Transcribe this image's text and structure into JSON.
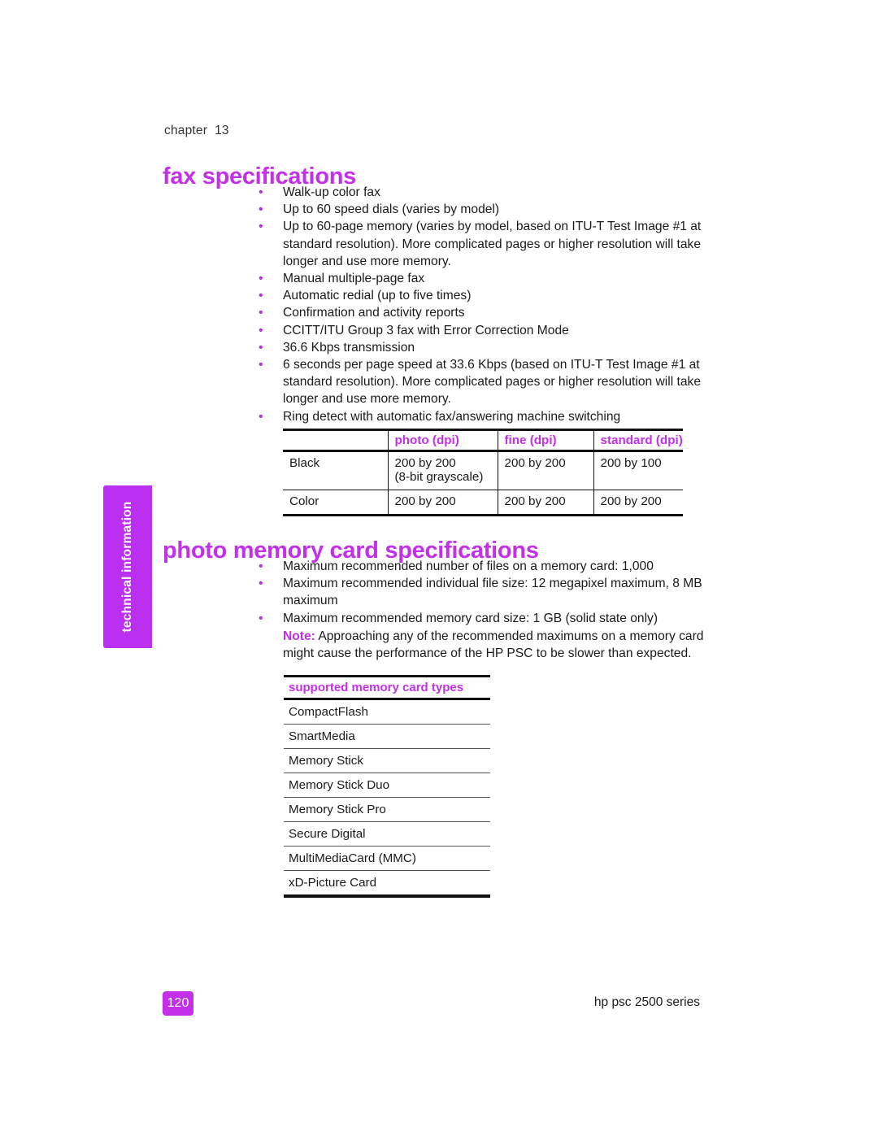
{
  "document": {
    "chapter_eyebrow": "chapter  13",
    "side_tab_label": "technical information",
    "page_number": "120",
    "footer_right": "hp psc 2500 series",
    "accent_color": "#c42fe9",
    "tab_color": "#bb2ff0"
  },
  "sections": [
    {
      "heading": "fax specifications",
      "bullets": [
        "Walk-up color fax",
        "Up to 60 speed dials (varies by model)",
        "Up to 60-page memory (varies by model, based on ITU-T Test Image #1 at standard resolution). More complicated pages or higher resolution will take longer and use more memory.",
        "Manual multiple-page fax",
        "Automatic redial (up to five times)",
        "Confirmation and activity reports",
        "CCITT/ITU Group 3 fax with Error Correction Mode",
        "36.6 Kbps transmission",
        "6 seconds per page speed at 33.6 Kbps (based on ITU-T Test Image #1 at standard resolution). More complicated pages or higher resolution will take longer and use more memory.",
        "Ring detect with automatic fax/answering machine switching"
      ]
    },
    {
      "heading": "photo memory card specifications",
      "bullets": [
        "Maximum recommended number of files on a memory card: 1,000",
        "Maximum recommended individual file size: 12 megapixel maximum, 8 MB maximum",
        "Maximum recommended memory card size: 1 GB (solid state only)"
      ],
      "note": {
        "label": "Note:",
        "text": "Approaching any of the recommended maximums on a memory card might cause the performance of the HP PSC to be slower than expected."
      }
    }
  ],
  "resolution_table": {
    "headers": [
      "",
      "photo (dpi)",
      "fine (dpi)",
      "standard (dpi)"
    ],
    "rows": [
      {
        "label": "Black",
        "photo_main": "200 by 200",
        "photo_sub": "(8-bit grayscale)",
        "fine": "200 by 200",
        "standard": "200 by 100"
      },
      {
        "label": "Color",
        "photo_main": "200 by 200",
        "photo_sub": "",
        "fine": "200 by 200",
        "standard": "200 by 200"
      }
    ]
  },
  "card_types_table": {
    "header": "supported memory card types",
    "rows": [
      "CompactFlash",
      "SmartMedia",
      "Memory Stick",
      "Memory Stick Duo",
      "Memory Stick Pro",
      "Secure Digital",
      "MultiMediaCard (MMC)",
      "xD-Picture Card"
    ]
  }
}
